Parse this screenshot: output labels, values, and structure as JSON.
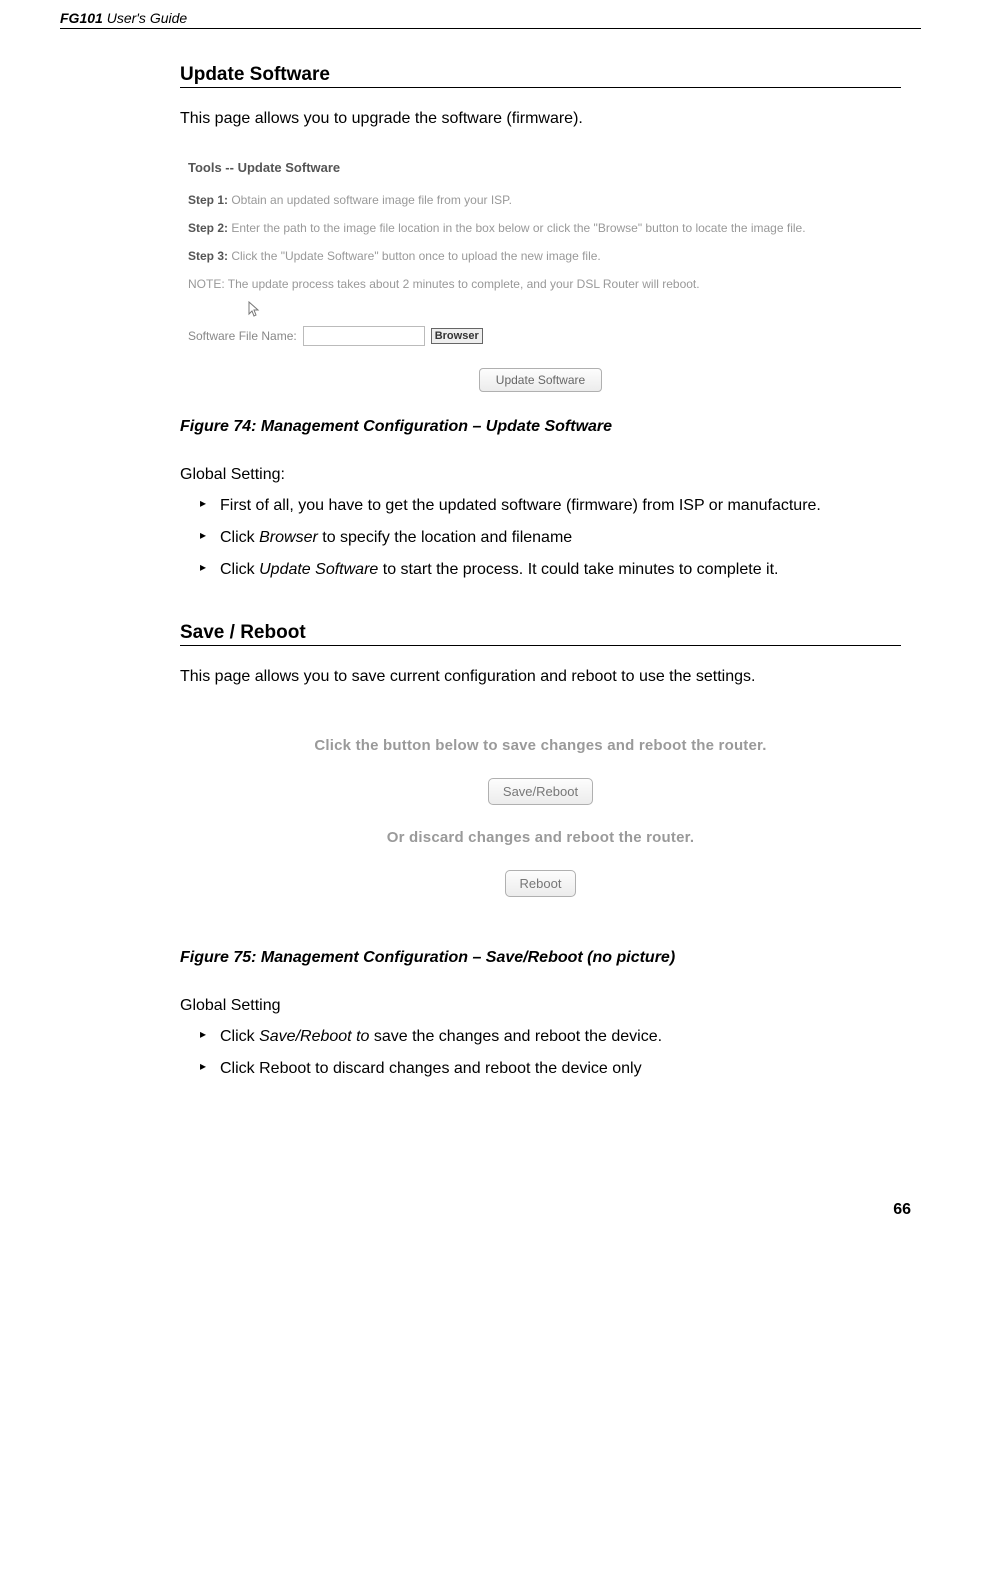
{
  "header": {
    "product": "FG101",
    "guide": " User's Guide"
  },
  "section1": {
    "title": "Update Software",
    "intro": "This page allows you to upgrade the software (firmware).",
    "screenshot": {
      "title": "Tools -- Update Software",
      "step1_label": "Step 1:",
      "step1_text": " Obtain an updated software image file from your ISP.",
      "step2_label": "Step 2:",
      "step2_text": " Enter the path to the image file location in the box below or click the \"Browse\" button to locate the image file.",
      "step3_label": "Step 3:",
      "step3_text": " Click the \"Update Software\" button once to upload the new image file.",
      "note": "NOTE: The update process takes about 2 minutes to complete, and your DSL Router will reboot.",
      "file_label": "Software File Name: ",
      "browse_btn": "Browser",
      "update_btn": "Update Software"
    },
    "figure_caption": "Figure 74: Management Configuration – Update Software",
    "global_label": "Global Setting:",
    "bullets": {
      "b1": "First of all, you have to get the updated software (firmware) from ISP or manufacture.",
      "b2_pre": "Click ",
      "b2_em": "Browser",
      "b2_post": " to specify the location and filename",
      "b3_pre": "Click ",
      "b3_em": "Update Software",
      "b3_post": " to start the process. It could take minutes to complete it."
    }
  },
  "section2": {
    "title": "Save / Reboot",
    "intro": "This page allows you to save current configuration and reboot to use the settings.",
    "screenshot": {
      "line1": "Click the button below to save changes and reboot the router.",
      "btn1": "Save/Reboot",
      "line2": "Or discard changes and reboot the router.",
      "btn2": "Reboot"
    },
    "figure_caption": "Figure 75: Management Configuration – Save/Reboot (no picture)",
    "global_label": "Global Setting",
    "bullets": {
      "b1_pre": "Click ",
      "b1_em": "Save/Reboot to ",
      "b1_post": "save the changes and reboot the device.",
      "b2": "Click Reboot to discard changes and reboot the device only"
    }
  },
  "page_number": "66"
}
